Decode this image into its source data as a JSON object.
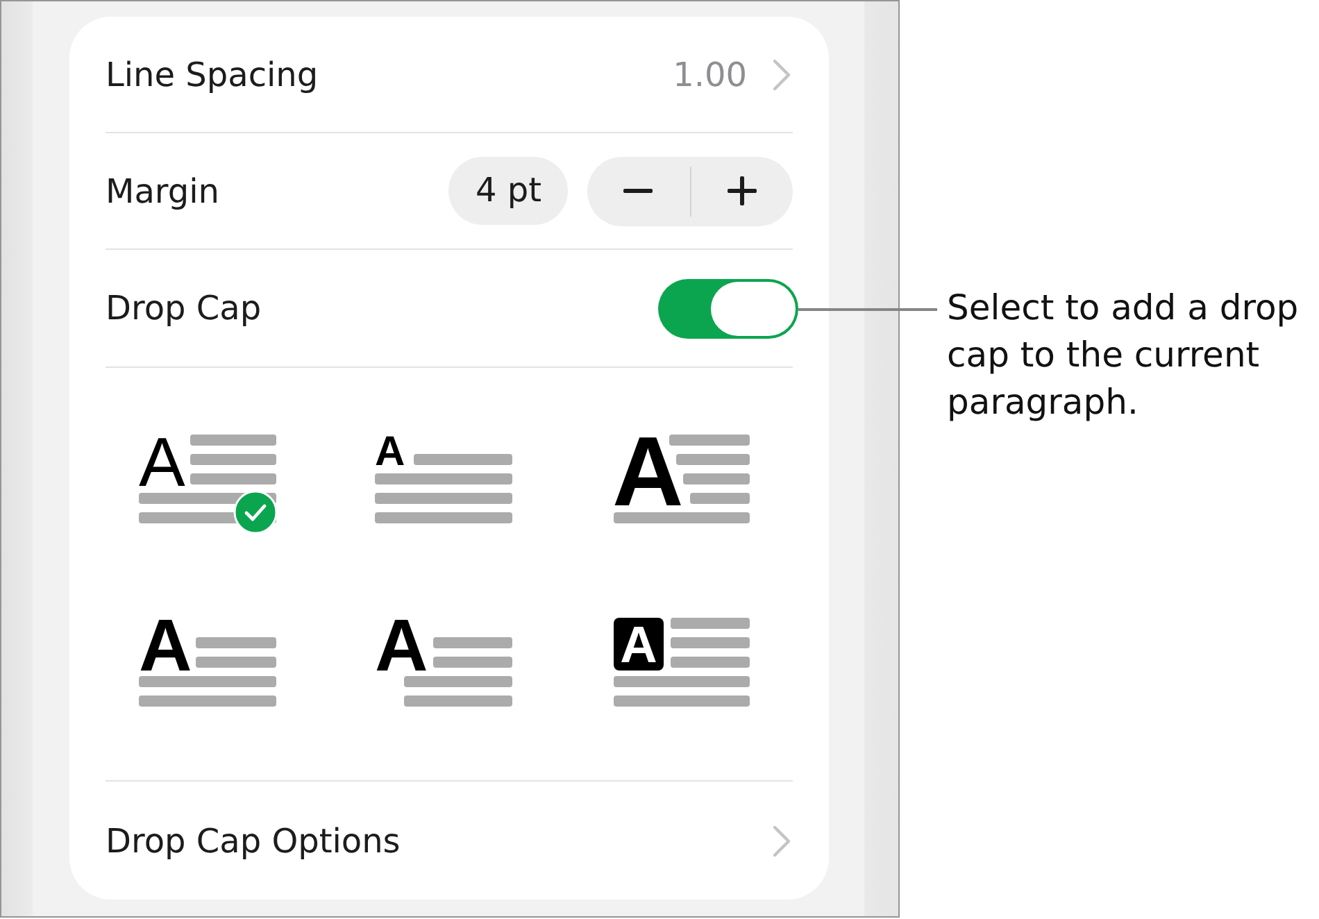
{
  "line_spacing": {
    "label": "Line Spacing",
    "value": "1.00"
  },
  "margin": {
    "label": "Margin",
    "value": "4 pt"
  },
  "drop_cap": {
    "label": "Drop Cap",
    "on": true
  },
  "styles": [
    {
      "kind": "inline-regular",
      "letter": "A",
      "selected": true
    },
    {
      "kind": "raised",
      "letter": "A",
      "selected": false
    },
    {
      "kind": "large-stepped",
      "letter": "A",
      "selected": false
    },
    {
      "kind": "two-line",
      "letter": "A",
      "selected": false
    },
    {
      "kind": "hanging",
      "letter": "A",
      "selected": false
    },
    {
      "kind": "boxed",
      "letter": "A",
      "selected": false
    }
  ],
  "options": {
    "label": "Drop Cap Options"
  },
  "callout": {
    "text": "Select to add a drop cap to the current paragraph."
  }
}
